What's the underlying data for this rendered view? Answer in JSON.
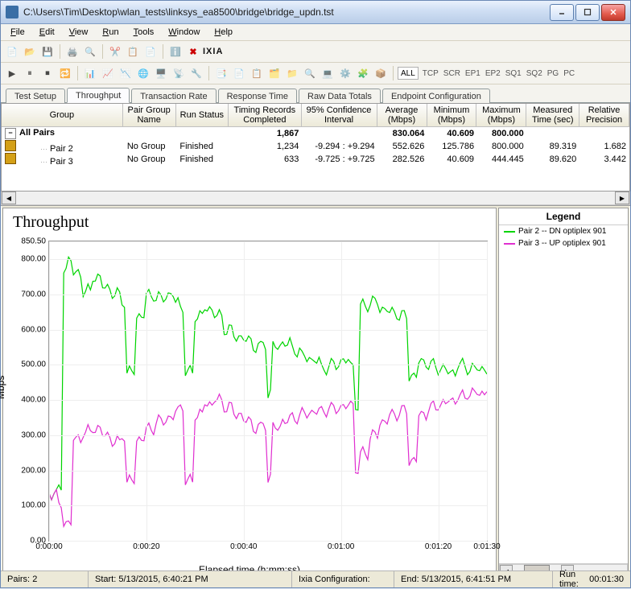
{
  "window": {
    "title": "C:\\Users\\Tim\\Desktop\\wlan_tests\\linksys_ea8500\\bridge\\bridge_updn.tst"
  },
  "menu": {
    "items": [
      "File",
      "Edit",
      "View",
      "Run",
      "Tools",
      "Window",
      "Help"
    ]
  },
  "toolbar2_labels": [
    "ALL",
    "TCP",
    "SCR",
    "EP1",
    "EP2",
    "SQ1",
    "SQ2",
    "PG",
    "PC"
  ],
  "tabs": [
    "Test Setup",
    "Throughput",
    "Transaction Rate",
    "Response Time",
    "Raw Data Totals",
    "Endpoint Configuration"
  ],
  "active_tab": 1,
  "grid": {
    "headers": [
      "Group",
      "Pair Group Name",
      "Run Status",
      "Timing Records Completed",
      "95% Confidence Interval",
      "Average (Mbps)",
      "Minimum (Mbps)",
      "Maximum (Mbps)",
      "Measured Time (sec)",
      "Relative Precision"
    ],
    "rows": [
      {
        "indent": 0,
        "expand": true,
        "group": "All Pairs",
        "bold": true,
        "pairgroup": "",
        "runstatus": "",
        "records": "1,867",
        "ci": "",
        "avg": "830.064",
        "min": "40.609",
        "max": "800.000",
        "time": "",
        "prec": ""
      },
      {
        "indent": 1,
        "icon": true,
        "group": "Pair 2",
        "pairgroup": "No Group",
        "runstatus": "Finished",
        "records": "1,234",
        "ci": "-9.294 : +9.294",
        "avg": "552.626",
        "min": "125.786",
        "max": "800.000",
        "time": "89.319",
        "prec": "1.682"
      },
      {
        "indent": 1,
        "icon": true,
        "group": "Pair 3",
        "pairgroup": "No Group",
        "runstatus": "Finished",
        "records": "633",
        "ci": "-9.725 : +9.725",
        "avg": "282.526",
        "min": "40.609",
        "max": "444.445",
        "time": "89.620",
        "prec": "3.442"
      }
    ]
  },
  "legend": {
    "title": "Legend",
    "items": [
      {
        "label": "Pair 2 -- DN optiplex 901",
        "color": "#00d400"
      },
      {
        "label": "Pair 3 -- UP optiplex 901",
        "color": "#e030d0"
      }
    ]
  },
  "status": {
    "pairs_label": "Pairs:",
    "pairs": "2",
    "start_label": "Start:",
    "start": "5/13/2015, 6:40:21 PM",
    "ixia_label": "Ixia Configuration:",
    "end_label": "End:",
    "end": "5/13/2015, 6:41:51 PM",
    "runtime_label": "Run time:",
    "runtime": "00:01:30"
  },
  "chart_data": {
    "type": "line",
    "title": "Throughput",
    "xlabel": "Elapsed time (h:mm:ss)",
    "ylabel": "Mbps",
    "ylim": [
      0,
      850.5
    ],
    "yticks": [
      0,
      100,
      200,
      300,
      400,
      500,
      600,
      700,
      800,
      850.5
    ],
    "xlim": [
      0,
      90
    ],
    "xticks": [
      0,
      20,
      40,
      60,
      80,
      90
    ],
    "xticklabels": [
      "0:00:00",
      "0:00:20",
      "0:00:40",
      "0:01:00",
      "0:01:20",
      "0:01:30"
    ],
    "series": [
      {
        "name": "Pair 2 -- DN optiplex 901",
        "color": "#00d400",
        "x": [
          0,
          2,
          3,
          4,
          5,
          7,
          9,
          11,
          13,
          15,
          16,
          18,
          20,
          22,
          24,
          26,
          27,
          28,
          30,
          32,
          34,
          36,
          38,
          40,
          42,
          44,
          45,
          46,
          48,
          50,
          52,
          54,
          56,
          58,
          60,
          62,
          63,
          64,
          66,
          68,
          70,
          72,
          74,
          76,
          78,
          80,
          82,
          84,
          86,
          88,
          90
        ],
        "y": [
          135,
          150,
          770,
          800,
          760,
          710,
          750,
          720,
          700,
          680,
          480,
          640,
          700,
          690,
          700,
          680,
          660,
          480,
          640,
          660,
          640,
          600,
          580,
          570,
          550,
          560,
          420,
          550,
          560,
          540,
          520,
          510,
          490,
          500,
          510,
          500,
          380,
          670,
          680,
          660,
          650,
          640,
          470,
          510,
          500,
          490,
          480,
          500,
          490,
          490,
          480
        ]
      },
      {
        "name": "Pair 3 -- UP optiplex 901",
        "color": "#e030d0",
        "x": [
          0,
          2,
          3,
          4,
          5,
          7,
          9,
          11,
          13,
          15,
          16,
          18,
          20,
          22,
          24,
          26,
          27,
          28,
          30,
          32,
          34,
          36,
          38,
          40,
          42,
          44,
          45,
          46,
          48,
          50,
          52,
          54,
          56,
          58,
          60,
          62,
          63,
          64,
          66,
          68,
          70,
          72,
          74,
          76,
          78,
          80,
          82,
          84,
          86,
          88,
          90
        ],
        "y": [
          135,
          100,
          50,
          50,
          290,
          310,
          320,
          300,
          280,
          300,
          170,
          290,
          320,
          340,
          350,
          370,
          380,
          170,
          360,
          390,
          400,
          380,
          360,
          340,
          320,
          330,
          180,
          320,
          340,
          350,
          360,
          365,
          370,
          375,
          380,
          390,
          200,
          250,
          300,
          340,
          360,
          370,
          230,
          360,
          380,
          390,
          400,
          410,
          420,
          420,
          430
        ]
      }
    ]
  }
}
